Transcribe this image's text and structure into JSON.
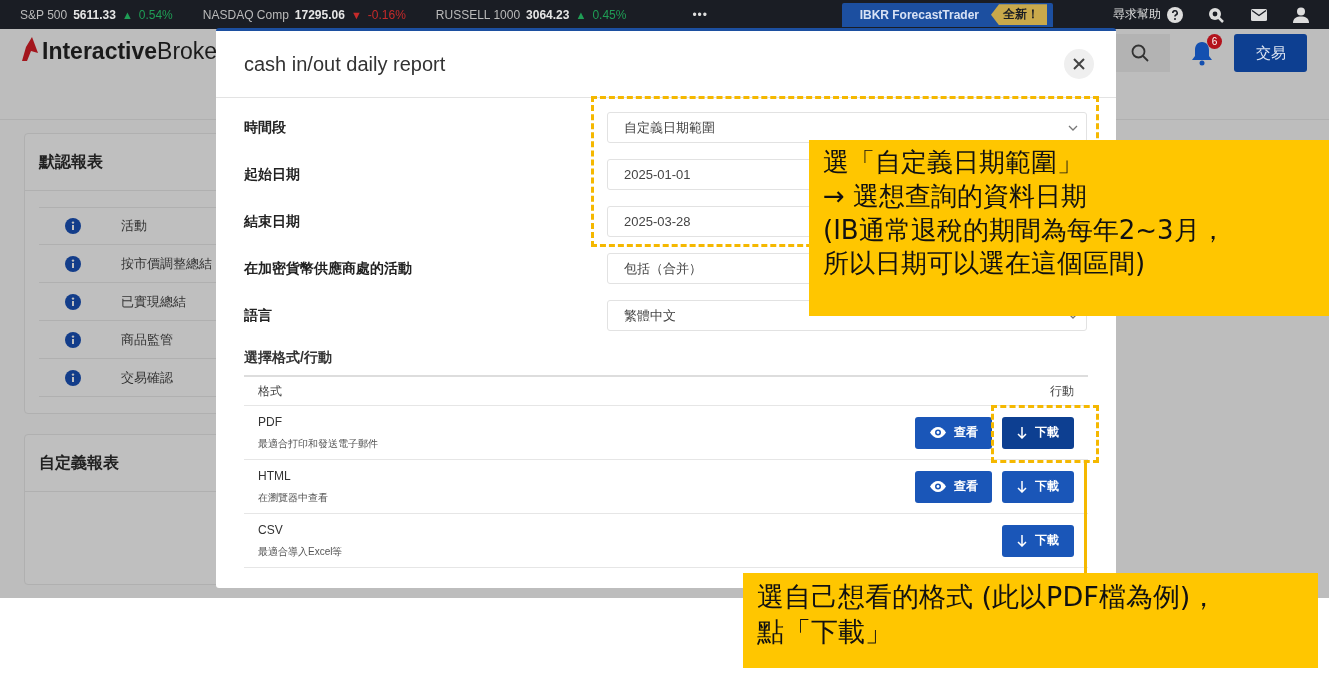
{
  "ticker": [
    {
      "name": "S&P 500",
      "value": "5611.33",
      "arrow": "▲",
      "change": "0.54%",
      "color": "#1f9d55"
    },
    {
      "name": "NASDAQ Comp",
      "value": "17295.06",
      "arrow": "▼",
      "change": "-0.16%",
      "color": "#c52a2a"
    },
    {
      "name": "RUSSELL 1000",
      "value": "3064.23",
      "arrow": "▲",
      "change": "0.45%",
      "color": "#1f9d55"
    }
  ],
  "top_bar": {
    "more": "•••",
    "promo": {
      "label": "IBKR ForecastTrader",
      "badge": "全新！"
    },
    "help": "尋求幫助"
  },
  "header": {
    "logo": {
      "bold": "Interactive",
      "light": "Broke"
    },
    "notification_count": "6",
    "trade_button": "交易"
  },
  "cards": [
    {
      "title": "默認報表",
      "items": [
        "活動",
        "按市價調整總結",
        "已實現總結",
        "商品監管",
        "交易確認"
      ]
    },
    {
      "title": "自定義報表"
    }
  ],
  "modal": {
    "title": "cash in/out daily report",
    "fields": [
      {
        "label": "時間段",
        "kind": "select",
        "value": "自定義日期範圍"
      },
      {
        "label": "起始日期",
        "kind": "date",
        "value": "2025-01-01"
      },
      {
        "label": "結束日期",
        "kind": "date",
        "value": "2025-03-28"
      },
      {
        "label": "在加密貨幣供應商處的活動",
        "kind": "select",
        "value": "包括（合并）"
      },
      {
        "label": "語言",
        "kind": "select",
        "value": "繁體中文"
      }
    ],
    "section_title": "選擇格式/行動",
    "columns": [
      "格式",
      "行動"
    ],
    "rows": [
      {
        "format": "PDF",
        "description": "最適合打印和發送電子郵件",
        "actions": [
          {
            "kind": "view",
            "label": "查看",
            "highlighted": false
          },
          {
            "kind": "download",
            "label": "下載",
            "highlighted": true
          }
        ]
      },
      {
        "format": "HTML",
        "description": "在瀏覽器中查看",
        "actions": [
          {
            "kind": "view",
            "label": "查看",
            "highlighted": false
          },
          {
            "kind": "download",
            "label": "下載",
            "highlighted": false
          }
        ]
      },
      {
        "format": "CSV",
        "description": "最適合導入Excel等",
        "actions": [
          {
            "kind": "download",
            "label": "下載",
            "highlighted": false
          }
        ]
      }
    ]
  },
  "annotations": [
    {
      "lines": [
        "選「自定義日期範圍」",
        "→ 選想查詢的資料日期",
        "(IB通常退稅的期間為每年2~3月，",
        "所以日期可以選在這個區間)"
      ]
    },
    {
      "lines": [
        "選自己想看的格式 (此以PDF檔為例)，",
        "點「下載」"
      ]
    }
  ]
}
